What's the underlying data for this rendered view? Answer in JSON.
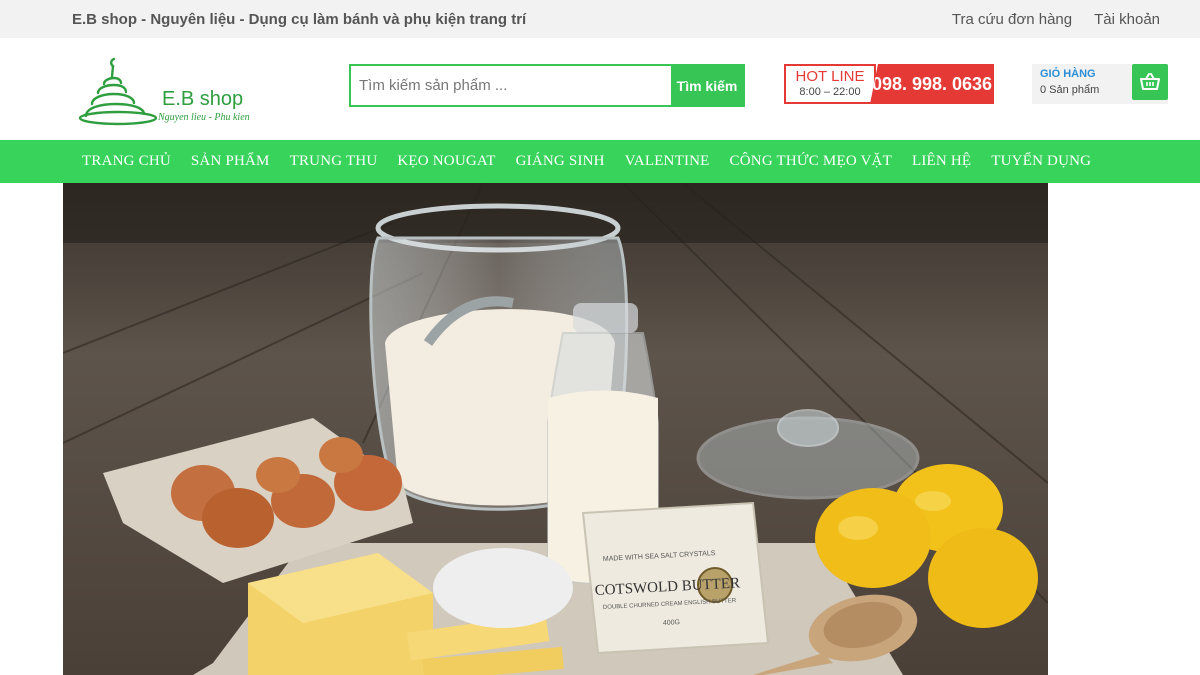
{
  "topbar": {
    "tagline": "E.B shop - Nguyên liệu - Dụng cụ làm bánh và phụ kiện trang trí",
    "links": [
      "Tra cứu đơn hàng",
      "Tài khoản"
    ]
  },
  "logo": {
    "brand": "E.B shop",
    "subtitle": "Nguyen lieu - Phu kien"
  },
  "search": {
    "placeholder": "Tìm kiếm sản phẩm ...",
    "value": "",
    "button": "Tìm kiếm"
  },
  "hotline": {
    "label": "HOT LINE",
    "hours": "8:00 – 22:00",
    "number": "098. 998. 0636"
  },
  "cart": {
    "title": "GIỎ HÀNG",
    "count": "0 Sản phẩm",
    "icon": "basket-icon"
  },
  "nav": {
    "items": [
      "TRANG CHỦ",
      "SẢN PHẨM",
      "TRUNG THU",
      "KẸO NOUGAT",
      "GIÁNG SINH",
      "VALENTINE",
      "CÔNG THỨC MẸO VẶT",
      "LIÊN HỆ",
      "TUYỂN DỤNG"
    ]
  },
  "hero": {
    "butter_brand": "COTSWOLD BUTTER",
    "butter_top": "MADE WITH SEA SALT CRYSTALS",
    "butter_bottom": "DOUBLE CHURNED CREAM ENGLISH BUTTER",
    "butter_weight": "400G"
  },
  "colors": {
    "accent": "#37c556",
    "nav": "#37d35a",
    "hotline": "#e53935",
    "cart_title": "#2b8fd6"
  }
}
